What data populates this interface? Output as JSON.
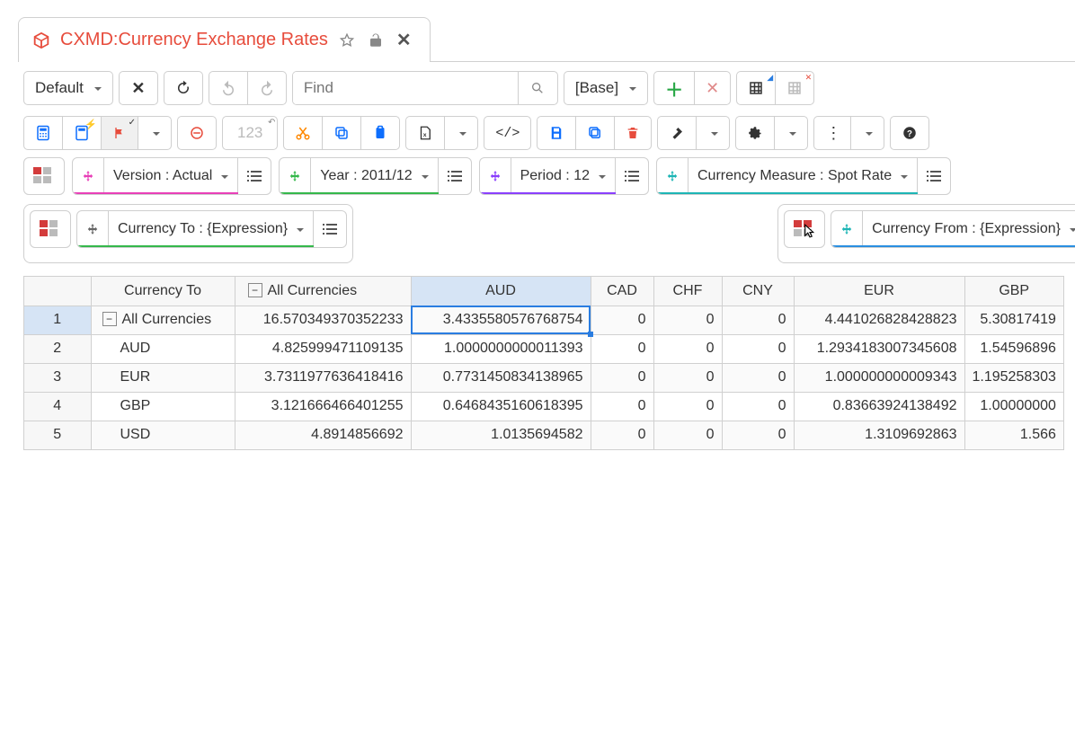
{
  "tab": {
    "title": "CXMD:Currency Exchange Rates"
  },
  "toolbar": {
    "view_selector": "Default",
    "find_placeholder": "Find",
    "base_selector": "[Base]",
    "number_placeholder": "123"
  },
  "dim_filters": [
    {
      "label": "Version : Actual",
      "color": "pink"
    },
    {
      "label": "Year : 2011/12",
      "color": "green"
    },
    {
      "label": "Period : 12",
      "color": "purple"
    },
    {
      "label": "Currency Measure : Spot Rate",
      "color": "teal"
    }
  ],
  "row_dim": {
    "label": "Currency To : {Expression}",
    "color": "green"
  },
  "col_dim": {
    "label": "Currency From : {Expression}",
    "color": "blue"
  },
  "grid": {
    "corner_label": "Currency To",
    "columns": [
      {
        "key": "all",
        "label": "All Currencies",
        "collapse": true
      },
      {
        "key": "aud",
        "label": "AUD",
        "selected": true
      },
      {
        "key": "cad",
        "label": "CAD"
      },
      {
        "key": "chf",
        "label": "CHF"
      },
      {
        "key": "cny",
        "label": "CNY"
      },
      {
        "key": "eur",
        "label": "EUR"
      },
      {
        "key": "gbp",
        "label": "GBP"
      }
    ],
    "rows": [
      {
        "n": "1",
        "label": "All Currencies",
        "collapse": true,
        "selected": true,
        "vals": [
          "16.570349370352233",
          "3.4335580576768754",
          "0",
          "0",
          "0",
          "4.441026828428823",
          "5.30817419"
        ]
      },
      {
        "n": "2",
        "label": "AUD",
        "vals": [
          "4.825999471109135",
          "1.0000000000011393",
          "0",
          "0",
          "0",
          "1.2934183007345608",
          "1.54596896"
        ]
      },
      {
        "n": "3",
        "label": "EUR",
        "vals": [
          "3.7311977636418416",
          "0.7731450834138965",
          "0",
          "0",
          "0",
          "1.000000000009343",
          "1.195258303"
        ]
      },
      {
        "n": "4",
        "label": "GBP",
        "vals": [
          "3.121666466401255",
          "0.6468435160618395",
          "0",
          "0",
          "0",
          "0.83663924138492",
          "1.00000000"
        ]
      },
      {
        "n": "5",
        "label": "USD",
        "vals": [
          "4.8914856692",
          "1.0135694582",
          "0",
          "0",
          "0",
          "1.3109692863",
          "1.566"
        ]
      }
    ],
    "selected_cell": {
      "row": 0,
      "col": 1
    }
  }
}
